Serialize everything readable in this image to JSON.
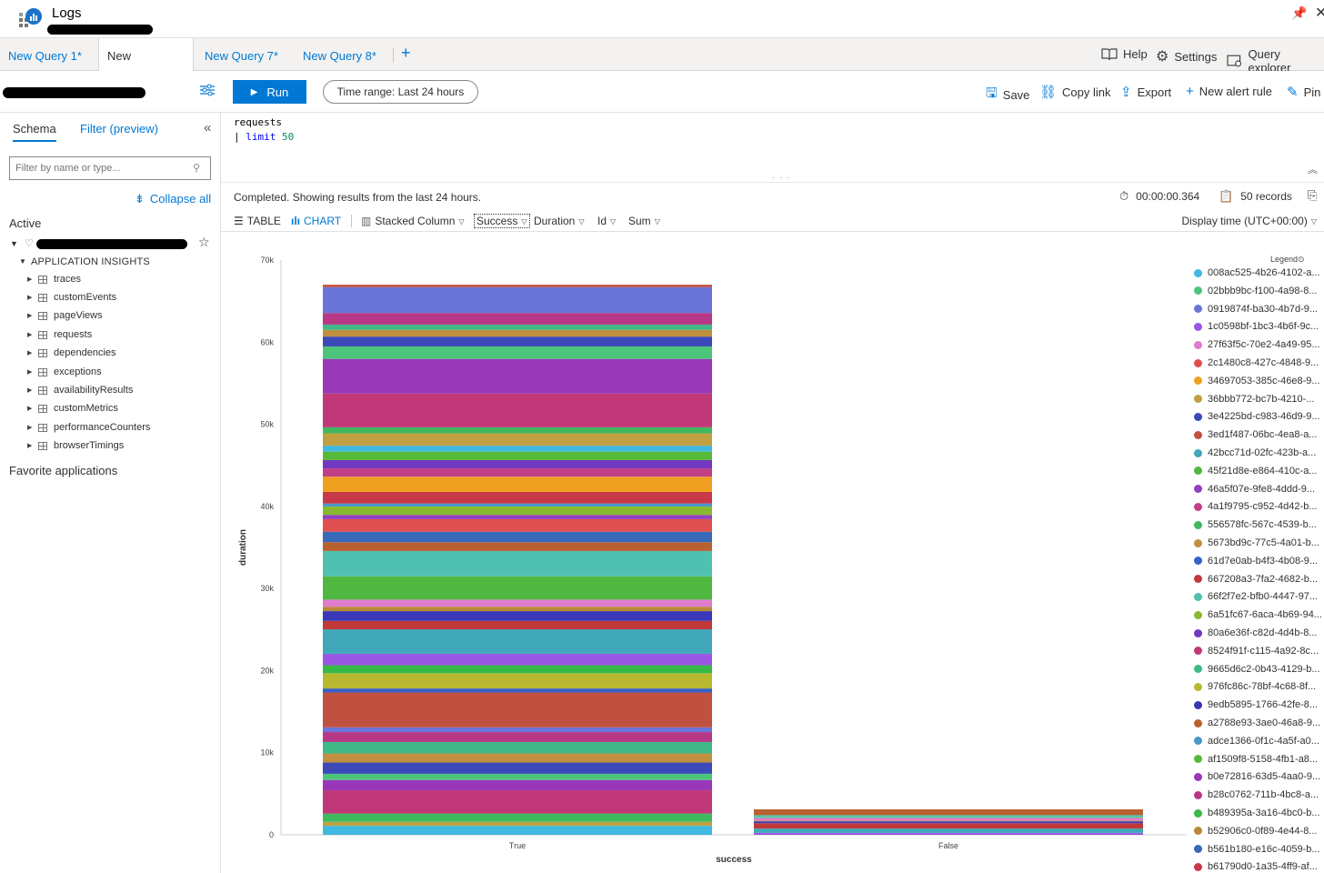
{
  "app": {
    "title": "Logs",
    "account_redacted": true
  },
  "tabs": [
    {
      "label": "New Query 1*",
      "active": false
    },
    {
      "label": "New Query...*",
      "active": true
    },
    {
      "label": "New Query 7*",
      "active": false
    },
    {
      "label": "New Query 8*",
      "active": false
    }
  ],
  "top_actions": {
    "help": "Help",
    "settings": "Settings",
    "query_explorer": "Query explorer"
  },
  "toolbar": {
    "run": "Run",
    "time_range": "Time range: Last 24 hours",
    "save": "Save",
    "copy_link": "Copy link",
    "export": "Export",
    "new_alert_rule": "New alert rule",
    "pin": "Pin"
  },
  "left_panel": {
    "tab_schema": "Schema",
    "tab_filter": "Filter (preview)",
    "filter_placeholder": "Filter by name or type...",
    "collapse_all": "Collapse all",
    "active_label": "Active",
    "app_insights_label": "APPLICATION INSIGHTS",
    "tables": [
      "traces",
      "customEvents",
      "pageViews",
      "requests",
      "dependencies",
      "exceptions",
      "availabilityResults",
      "customMetrics",
      "performanceCounters",
      "browserTimings"
    ],
    "favorites_label": "Favorite applications"
  },
  "editor": {
    "line1": "requests",
    "line2_pipe": "| ",
    "line2_kw": "limit",
    "line2_num": "50"
  },
  "results": {
    "status": "Completed. Showing results from the last 24 hours.",
    "duration": "00:00:00.364",
    "records": "50 records",
    "view_table": "TABLE",
    "view_chart": "CHART",
    "chart_type": "Stacked Column",
    "x_col": "Success",
    "y_col": "Duration",
    "split_col": "Id",
    "aggregation": "Sum",
    "display_time": "Display time (UTC+00:00)"
  },
  "legend_title": "Legend",
  "colors": {
    "accent": "#0078d4"
  },
  "chart_data": {
    "type": "bar",
    "stacked": true,
    "xlabel": "success",
    "ylabel": "duration",
    "categories": [
      "True",
      "False"
    ],
    "ylim": [
      0,
      70000
    ],
    "yticks": [
      "0",
      "10k",
      "20k",
      "30k",
      "40k",
      "50k",
      "60k",
      "70k"
    ],
    "totals": [
      67000,
      3100
    ],
    "legend_placement": "right",
    "series_legend": [
      {
        "name": "008ac525-4b26-4102-a...",
        "color": "#3fb9e0"
      },
      {
        "name": "02bbb9bc-f100-4a98-8...",
        "color": "#4cc47a"
      },
      {
        "name": "0919874f-ba30-4b7d-9...",
        "color": "#6b74d8"
      },
      {
        "name": "1c0598bf-1bc3-4b6f-9c...",
        "color": "#9a57e6"
      },
      {
        "name": "27f63f5c-70e2-4a49-95...",
        "color": "#e07ccc"
      },
      {
        "name": "2c1480c8-427c-4848-9...",
        "color": "#e05050"
      },
      {
        "name": "34697053-385c-46e8-9...",
        "color": "#f0a020"
      },
      {
        "name": "36bbb772-bc7b-4210-...",
        "color": "#c0a040"
      },
      {
        "name": "3e4225bd-c983-46d9-9...",
        "color": "#3b4ab8"
      },
      {
        "name": "3ed1f487-06bc-4ea8-a...",
        "color": "#c05040"
      },
      {
        "name": "42bcc71d-02fc-423b-a...",
        "color": "#40a8b8"
      },
      {
        "name": "45f21d8e-e864-410c-a...",
        "color": "#50b840"
      },
      {
        "name": "46a5f07e-9fe8-4ddd-9...",
        "color": "#9040c0"
      },
      {
        "name": "4a1f9795-c952-4d42-b...",
        "color": "#c04088"
      },
      {
        "name": "556578fc-567c-4539-b...",
        "color": "#40b860"
      },
      {
        "name": "5673bd9c-77c5-4a01-b...",
        "color": "#c09040"
      },
      {
        "name": "61d7e0ab-b4f3-4b08-9...",
        "color": "#3860c8"
      },
      {
        "name": "667208a3-7fa2-4682-b...",
        "color": "#c03838"
      },
      {
        "name": "66f2f7e2-bfb0-4447-97...",
        "color": "#50c0b0"
      },
      {
        "name": "6a51fc67-6aca-4b69-94...",
        "color": "#88b830"
      },
      {
        "name": "80a6e36f-c82d-4d4b-8...",
        "color": "#7038c0"
      },
      {
        "name": "8524f91f-c115-4a92-8c...",
        "color": "#c03878"
      },
      {
        "name": "9665d6c2-0b43-4129-b...",
        "color": "#40b888"
      },
      {
        "name": "976fc86c-78bf-4c68-8f...",
        "color": "#b8b830"
      },
      {
        "name": "9edb5895-1766-42fe-8...",
        "color": "#3838b8"
      },
      {
        "name": "a2788e93-3ae0-46a8-9...",
        "color": "#b86030"
      },
      {
        "name": "adce1366-0f1c-4a5f-a0...",
        "color": "#4898c8"
      },
      {
        "name": "af1509f8-5158-4fb1-a8...",
        "color": "#58b838"
      },
      {
        "name": "b0e72816-63d5-4aa0-9...",
        "color": "#9838b8"
      },
      {
        "name": "b28c0762-711b-4bc8-a...",
        "color": "#b83888"
      },
      {
        "name": "b489395a-3a16-4bc0-b...",
        "color": "#38b848"
      },
      {
        "name": "b52906c0-0f89-4e44-8...",
        "color": "#b88838"
      },
      {
        "name": "b561b180-e16c-4059-b...",
        "color": "#3868b8"
      },
      {
        "name": "b61790d0-1a35-4ff9-af...",
        "color": "#c83848"
      }
    ]
  }
}
